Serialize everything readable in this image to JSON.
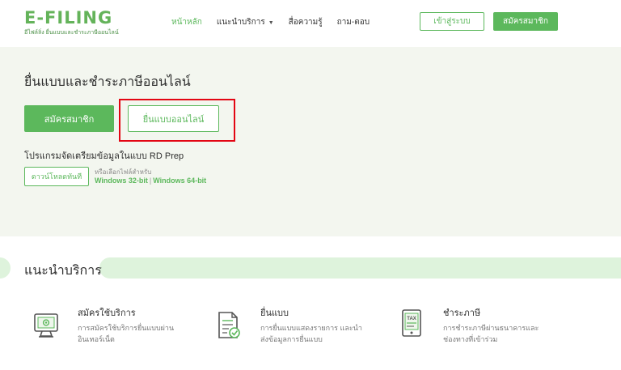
{
  "header": {
    "logo": "E-FILING",
    "logo_sub": "อีไฟล์ลิ่ง ยื่นแบบและชำระภาษีออนไลน์",
    "nav": [
      {
        "label": "หน้าหลัก",
        "active": true
      },
      {
        "label": "แนะนำบริการ",
        "has_caret": true
      },
      {
        "label": "สื่อความรู้"
      },
      {
        "label": "ถาม-ตอบ"
      }
    ],
    "login_label": "เข้าสู่ระบบ",
    "register_label": "สมัครสมาชิก"
  },
  "hero": {
    "title": "ยื่นแบบและชำระภาษีออนไลน์",
    "register_label": "สมัครสมาชิก",
    "file_online_label": "ยื่นแบบออนไลน์",
    "rdprep_label": "โปรแกรมจัดเตรียมข้อมูลในแบบ RD Prep",
    "download_label": "ดาวน์โหลดทันที",
    "or_select": "หรือเลือกไฟล์สำหรับ",
    "win32": "Windows 32-bit",
    "separator": "|",
    "win64": "Windows 64-bit"
  },
  "services": {
    "title": "แนะนำบริการ",
    "items": [
      {
        "name": "สมัครใช้บริการ",
        "desc1": "การสมัครใช้บริการยื่นแบบผ่าน",
        "desc2": "อินเทอร์เน็ต",
        "icon": "computer-at-icon"
      },
      {
        "name": "ยื่นแบบ",
        "desc1": "การยื่นแบบแสดงรายการ และนำ",
        "desc2": "ส่งข้อมูลการยื่นแบบ",
        "icon": "document-check-icon"
      },
      {
        "name": "ชำระภาษี",
        "desc1": "การชำระภาษีผ่านธนาคารและ",
        "desc2": "ช่องทางที่เข้าร่วม",
        "icon": "tax-tablet-icon"
      }
    ],
    "tax_text": "TAX"
  },
  "colors": {
    "accent": "#5cb85c",
    "highlight": "#e30613",
    "hero_bg": "#f3f6ef",
    "band": "#def3dc"
  }
}
